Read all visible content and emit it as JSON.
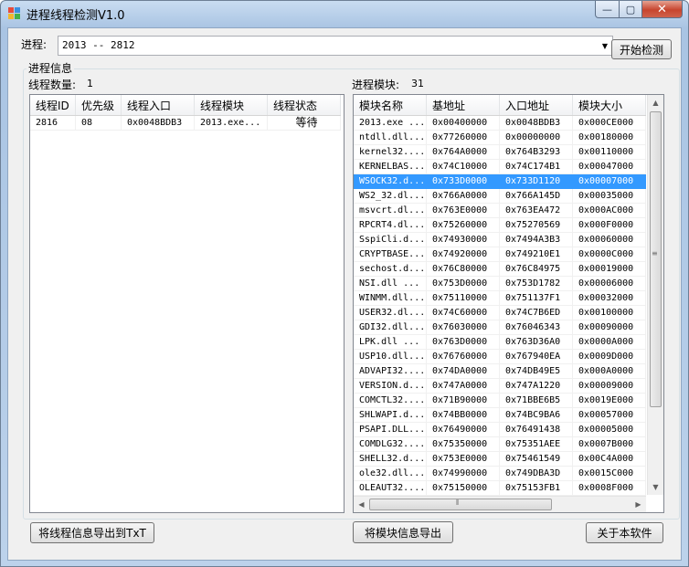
{
  "window": {
    "title": "进程线程检测V1.0",
    "minimize_glyph": "—",
    "maximize_glyph": "▢",
    "close_glyph": "✕"
  },
  "process": {
    "label": "进程:",
    "selected": "2013 -- 2812",
    "start_button": "开始检测"
  },
  "group": {
    "title": "进程信息"
  },
  "threads": {
    "count_label": "线程数量:",
    "count": "1",
    "columns": [
      "线程ID",
      "优先级",
      "线程入口",
      "线程模块",
      "线程状态"
    ],
    "rows": [
      [
        "2816",
        "08",
        "0x0048BDB3",
        "2013.exe...",
        "等待"
      ]
    ],
    "export_button": "将线程信息导出到TxT"
  },
  "modules": {
    "count_label": "进程模块:",
    "count": "31",
    "columns": [
      "模块名称",
      "基地址",
      "入口地址",
      "模块大小"
    ],
    "selected_index": 4,
    "rows": [
      [
        "2013.exe ...",
        "0x00400000",
        "0x0048BDB3",
        "0x000CE000"
      ],
      [
        "ntdll.dll...",
        "0x77260000",
        "0x00000000",
        "0x00180000"
      ],
      [
        "kernel32....",
        "0x764A0000",
        "0x764B3293",
        "0x00110000"
      ],
      [
        "KERNELBAS...",
        "0x74C10000",
        "0x74C174B1",
        "0x00047000"
      ],
      [
        "WSOCK32.d...",
        "0x733D0000",
        "0x733D1120",
        "0x00007000"
      ],
      [
        "WS2_32.dl...",
        "0x766A0000",
        "0x766A145D",
        "0x00035000"
      ],
      [
        "msvcrt.dl...",
        "0x763E0000",
        "0x763EA472",
        "0x000AC000"
      ],
      [
        "RPCRT4.dl...",
        "0x75260000",
        "0x75270569",
        "0x000F0000"
      ],
      [
        "SspiCli.d...",
        "0x74930000",
        "0x7494A3B3",
        "0x00060000"
      ],
      [
        "CRYPTBASE...",
        "0x74920000",
        "0x749210E1",
        "0x0000C000"
      ],
      [
        "sechost.d...",
        "0x76C80000",
        "0x76C84975",
        "0x00019000"
      ],
      [
        "NSI.dll  ...",
        "0x753D0000",
        "0x753D1782",
        "0x00006000"
      ],
      [
        "WINMM.dll...",
        "0x75110000",
        "0x751137F1",
        "0x00032000"
      ],
      [
        "USER32.dl...",
        "0x74C60000",
        "0x74C7B6ED",
        "0x00100000"
      ],
      [
        "GDI32.dll...",
        "0x76030000",
        "0x76046343",
        "0x00090000"
      ],
      [
        "LPK.dll  ...",
        "0x763D0000",
        "0x763D36A0",
        "0x0000A000"
      ],
      [
        "USP10.dll...",
        "0x76760000",
        "0x767940EA",
        "0x0009D000"
      ],
      [
        "ADVAPI32....",
        "0x74DA0000",
        "0x74DB49E5",
        "0x000A0000"
      ],
      [
        "VERSION.d...",
        "0x747A0000",
        "0x747A1220",
        "0x00009000"
      ],
      [
        "COMCTL32....",
        "0x71B90000",
        "0x71BBE6B5",
        "0x0019E000"
      ],
      [
        "SHLWAPI.d...",
        "0x74BB0000",
        "0x74BC9BA6",
        "0x00057000"
      ],
      [
        "PSAPI.DLL...",
        "0x76490000",
        "0x76491438",
        "0x00005000"
      ],
      [
        "COMDLG32....",
        "0x75350000",
        "0x75351AEE",
        "0x0007B000"
      ],
      [
        "SHELL32.d...",
        "0x753E0000",
        "0x75461549",
        "0x00C4A000"
      ],
      [
        "ole32.dll...",
        "0x74990000",
        "0x749DBA3D",
        "0x0015C000"
      ],
      [
        "OLEAUT32....",
        "0x75150000",
        "0x75153FB1",
        "0x0008F000"
      ]
    ],
    "export_button": "将模块信息导出"
  },
  "about_button": "关于本软件"
}
